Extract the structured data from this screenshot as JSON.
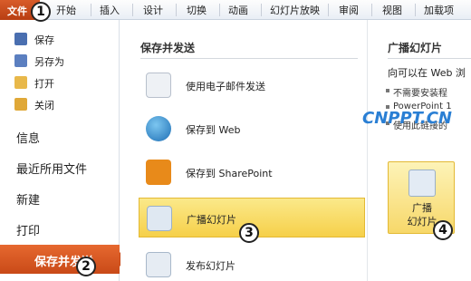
{
  "tabs": [
    "文件",
    "开始",
    "插入",
    "设计",
    "切换",
    "动画",
    "幻灯片放映",
    "审阅",
    "视图",
    "加载项"
  ],
  "nav": {
    "save": "保存",
    "save_as": "另存为",
    "open": "打开",
    "close": "关闭",
    "info": "信息",
    "recent": "最近所用文件",
    "new": "新建",
    "print": "打印",
    "save_send": "保存并发送"
  },
  "middle": {
    "title": "保存并发送",
    "options": [
      "使用电子邮件发送",
      "保存到 Web",
      "保存到 SharePoint",
      "广播幻灯片",
      "发布幻灯片"
    ]
  },
  "right": {
    "title": "广播幻灯片",
    "desc": "向可以在 Web 浏",
    "bullets": [
      "不需要安装程",
      "PowerPoint 1",
      "使用此链接的"
    ],
    "button_line1": "广播",
    "button_line2": "幻灯片"
  },
  "badges": [
    "1",
    "2",
    "3",
    "4"
  ],
  "watermark": "CNPPT.CN",
  "colors": {
    "accent": "#c94a18",
    "highlight": "#f6d04a",
    "watermark": "#2a7fd4"
  }
}
